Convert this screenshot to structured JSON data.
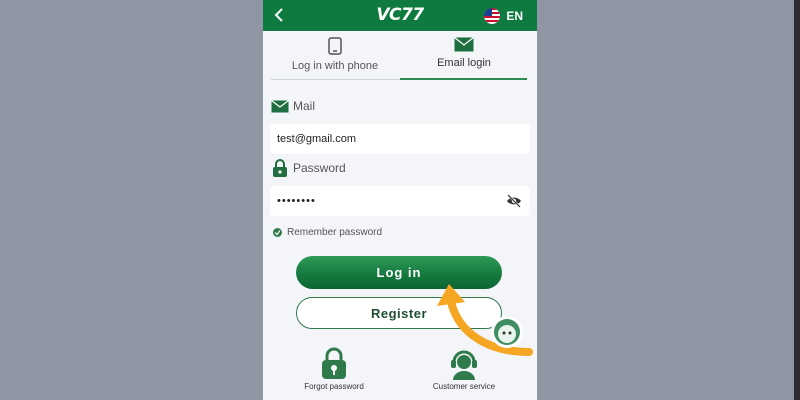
{
  "header": {
    "logo_text": "VC77",
    "language": "EN"
  },
  "tabs": [
    {
      "label": "Log in with phone",
      "icon": "phone-icon",
      "active": false
    },
    {
      "label": "Email login",
      "icon": "mail-icon",
      "active": true
    }
  ],
  "form": {
    "mail_label": "Mail",
    "mail_value": "test@gmail.com",
    "password_label": "Password",
    "password_value": "••••••••",
    "remember_label": "Remember password"
  },
  "buttons": {
    "login": "Log in",
    "register": "Register"
  },
  "quick_links": {
    "forgot": "Forgot password",
    "service": "Customer service"
  },
  "colors": {
    "brand_green": "#0f7a3f",
    "arrow_orange": "#f5a623",
    "page_background": "#8f95a3"
  }
}
